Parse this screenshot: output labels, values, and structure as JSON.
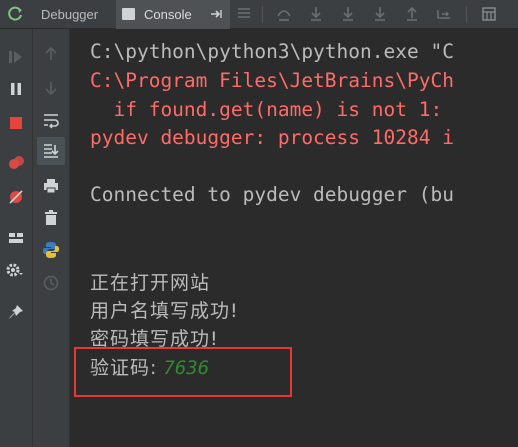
{
  "tabs": {
    "debugger_label": "Debugger",
    "console_label": "Console"
  },
  "console": {
    "lines": [
      {
        "text": "C:\\python\\python3\\python.exe \"C",
        "kind": "normal"
      },
      {
        "text": "C:\\Program Files\\JetBrains\\PyCh",
        "kind": "error"
      },
      {
        "text": "  if found.get(name) is not 1:",
        "kind": "error"
      },
      {
        "text": "pydev debugger: process 10284 i",
        "kind": "error"
      },
      {
        "text": "",
        "kind": "normal"
      },
      {
        "text": "Connected to pydev debugger (bu",
        "kind": "normal"
      },
      {
        "text": "",
        "kind": "normal"
      },
      {
        "text": "",
        "kind": "normal"
      },
      {
        "text": "正在打开网站",
        "kind": "cjk"
      },
      {
        "text": "用户名填写成功!",
        "kind": "cjk"
      },
      {
        "text": "密码填写成功!",
        "kind": "cjk"
      }
    ],
    "captcha_label": "验证码:",
    "captcha_value": "7636"
  },
  "colors": {
    "normal_text": "#bbbbbb",
    "error_text": "#ff6b68",
    "value_text": "#2e8b2e",
    "highlight_border": "#e53935",
    "background": "#2b2b2b",
    "panel": "#3c3f41"
  }
}
